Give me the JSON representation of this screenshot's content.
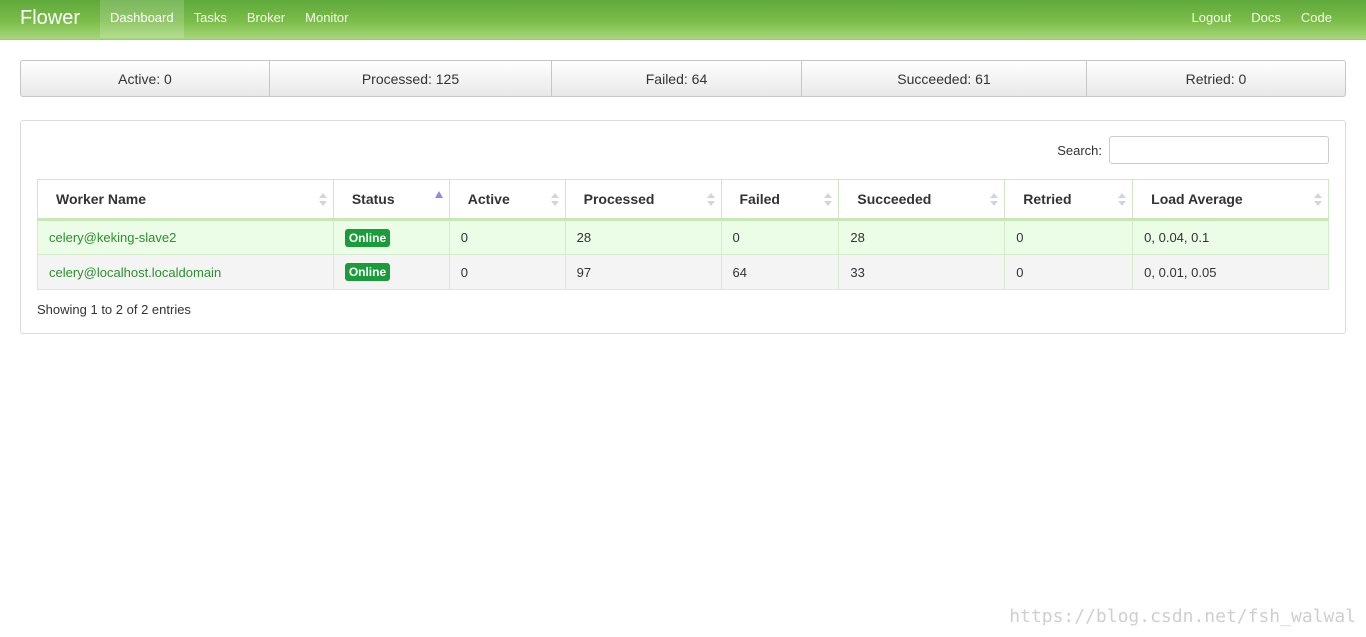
{
  "navbar": {
    "brand": "Flower",
    "left_items": [
      "Dashboard",
      "Tasks",
      "Broker",
      "Monitor"
    ],
    "active_item": "Dashboard",
    "right_items": [
      "Logout",
      "Docs",
      "Code"
    ]
  },
  "stats": {
    "active": "Active: 0",
    "processed": "Processed: 125",
    "failed": "Failed: 64",
    "succeeded": "Succeeded: 61",
    "retried": "Retried: 0"
  },
  "search": {
    "label": "Search:",
    "value": "",
    "placeholder": ""
  },
  "table": {
    "columns": [
      "Worker Name",
      "Status",
      "Active",
      "Processed",
      "Failed",
      "Succeeded",
      "Retried",
      "Load Average"
    ],
    "sorted_column": "Status",
    "rows": [
      {
        "name": "celery@keking-slave2",
        "status": "Online",
        "active": "0",
        "processed": "28",
        "failed": "0",
        "succeeded": "28",
        "retried": "0",
        "load": "0, 0.04, 0.1"
      },
      {
        "name": "celery@localhost.localdomain",
        "status": "Online",
        "active": "0",
        "processed": "97",
        "failed": "64",
        "succeeded": "33",
        "retried": "0",
        "load": "0, 0.01, 0.05"
      }
    ],
    "info": "Showing 1 to 2 of 2 entries"
  },
  "watermark": "https://blog.csdn.net/fsh_walwal",
  "colors": {
    "navbar": "#6fb543",
    "badge": "#1a9c3a",
    "worker_link": "#2d8f2d"
  }
}
